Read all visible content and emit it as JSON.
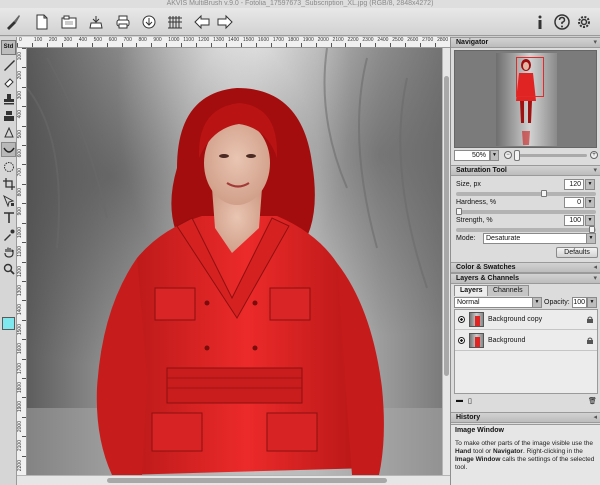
{
  "window": {
    "title": "AKVIS MultiBrush v.9.0 - Fotolia_17597673_Subscription_XL.jpg (RGB/8, 2848x4272)"
  },
  "toolbar": {
    "buttons": [
      "brush-logo",
      "new-file",
      "open-file",
      "save-file",
      "print",
      "share",
      "image-settings",
      "undo",
      "redo",
      "info",
      "help",
      "settings"
    ]
  },
  "tools": {
    "std_label": "Std",
    "swatch_color": "#7fe7ee"
  },
  "rulers": {
    "top": [
      "0",
      "100",
      "200",
      "300",
      "400",
      "500",
      "600",
      "700",
      "800",
      "900",
      "1000",
      "1100",
      "1200",
      "1300",
      "1400",
      "1500",
      "1600",
      "1700",
      "1800",
      "1900",
      "2000",
      "2100",
      "2200",
      "2300",
      "2400",
      "2500",
      "2600",
      "2700",
      "2800"
    ],
    "left": [
      "100",
      "200",
      "300",
      "400",
      "500",
      "600",
      "700",
      "800",
      "900",
      "1000",
      "1100",
      "1200",
      "1300",
      "1400",
      "1500",
      "1600",
      "1700",
      "1800",
      "1900",
      "2000",
      "2100",
      "2200"
    ]
  },
  "navigator": {
    "title": "Navigator",
    "zoom": "50%"
  },
  "saturation_tool": {
    "title": "Saturation Tool",
    "size_label": "Size, px",
    "size_value": "120",
    "hardness_label": "Hardness, %",
    "hardness_value": "0",
    "strength_label": "Strength, %",
    "strength_value": "100",
    "mode_label": "Mode:",
    "mode_value": "Desaturate",
    "defaults_label": "Defaults"
  },
  "color_swatches": {
    "title": "Color & Swatches"
  },
  "layers_channels": {
    "title": "Layers & Channels",
    "tabs": [
      "Layers",
      "Channels"
    ],
    "blend_mode": "Normal",
    "opacity_label": "Opacity:",
    "opacity_value": "100",
    "layers": [
      {
        "name": "Background copy"
      },
      {
        "name": "Background"
      }
    ]
  },
  "history": {
    "title": "History"
  },
  "help": {
    "title": "Image Window",
    "line1": "To make other parts of the image visible use the",
    "hand_tool": "Hand",
    "line2": "tool or",
    "navigator": "Navigator",
    "line3": ".",
    "line4": "Right-clicking in the",
    "image_window": "Image Window",
    "line5": "calls the settings of the selected tool."
  },
  "colors": {
    "accent_red": "#e12a2a",
    "panel_bg": "#dcdcdc"
  }
}
